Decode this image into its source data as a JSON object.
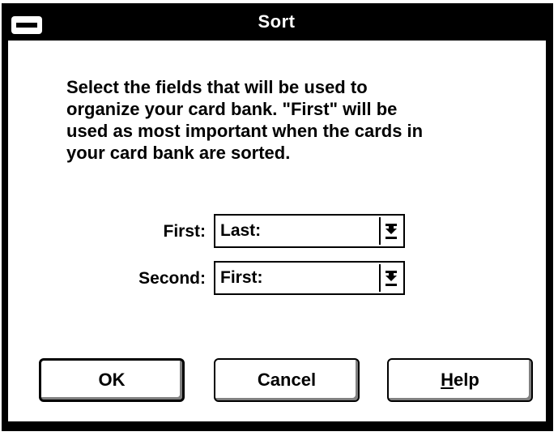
{
  "dialog": {
    "title": "Sort",
    "system_menu_icon": "minus-bar-icon",
    "description": "Select the fields that will be used to\norganize your card bank.  \"First\" will be\nused as most important when the cards in\nyour card bank are sorted.",
    "fields": [
      {
        "label": "First:",
        "value": "Last:",
        "dropdown_icon": "down-arrow-icon"
      },
      {
        "label": "Second:",
        "value": "First:",
        "dropdown_icon": "down-arrow-icon"
      }
    ],
    "buttons": {
      "ok": "OK",
      "cancel": "Cancel",
      "help_mnemonic": "H",
      "help_rest": "elp"
    }
  },
  "colors": {
    "titlebar": "#000000",
    "title_text": "#ffffff",
    "client_bg": "#ffffff",
    "text": "#000000"
  }
}
